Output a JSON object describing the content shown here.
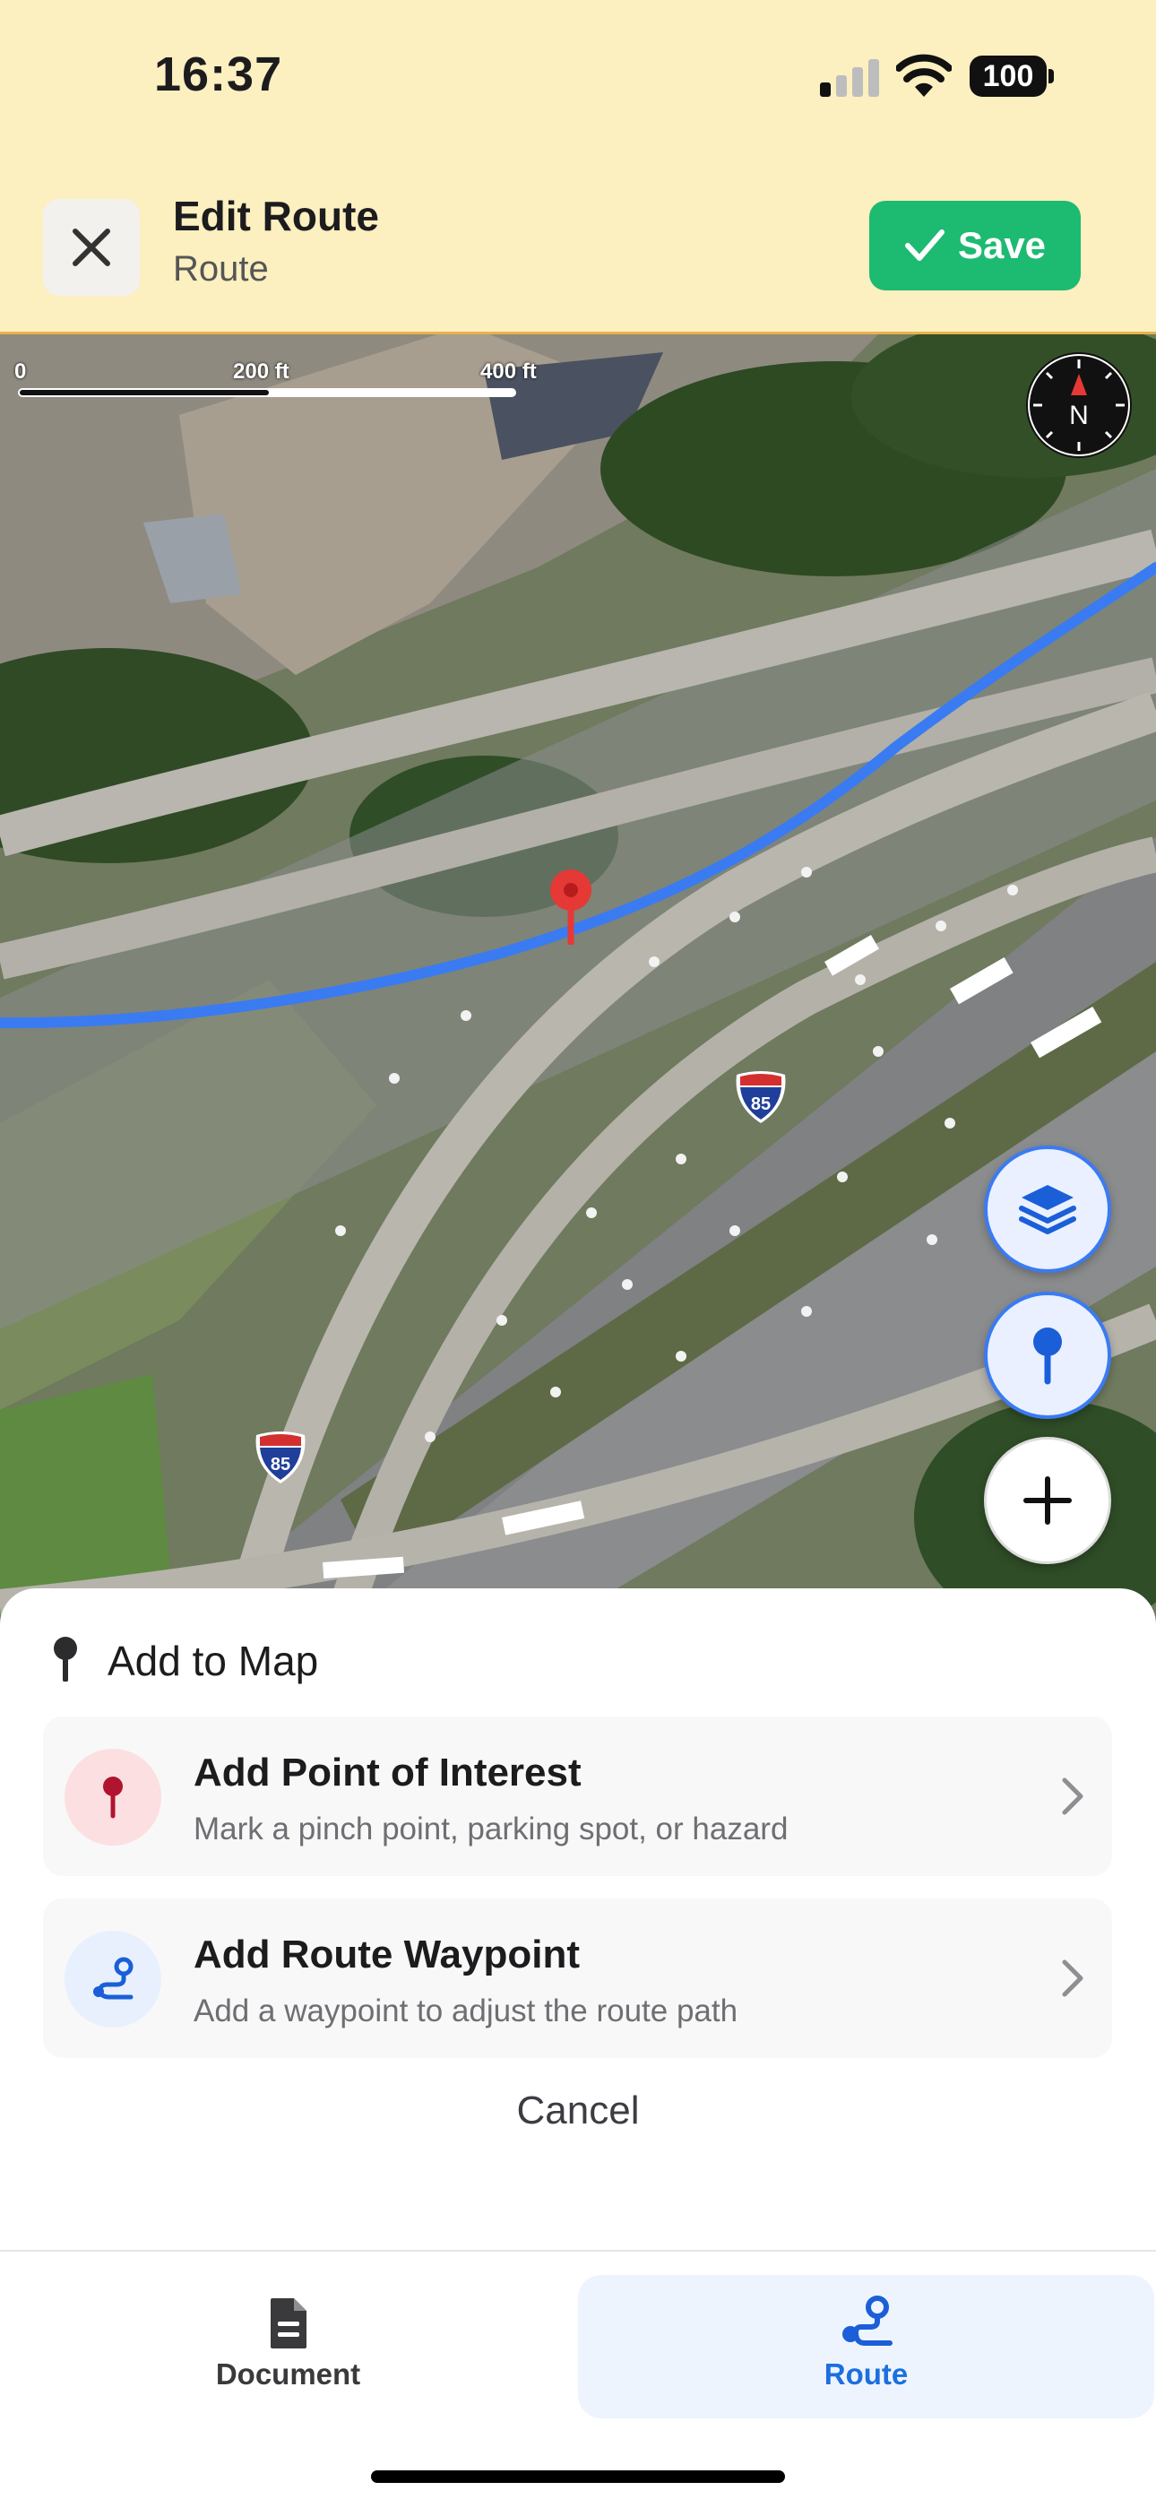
{
  "status_bar": {
    "time": "16:37",
    "battery": "100"
  },
  "header": {
    "title": "Edit Route",
    "subtitle": "Route",
    "save_label": "Save"
  },
  "map": {
    "scale_labels": [
      "0",
      "200 ft",
      "400 ft"
    ],
    "compass_label": "N",
    "shield_label": "85",
    "route_color": "#3a7bf2",
    "pin_color": "#e53935"
  },
  "sheet": {
    "title": "Add to Map",
    "options": [
      {
        "title": "Add Point of Interest",
        "subtitle": "Mark a pinch point, parking spot, or hazard",
        "icon": "pin-icon",
        "icon_bg": "#fcdfe1"
      },
      {
        "title": "Add Route Waypoint",
        "subtitle": "Add a waypoint to adjust the route path",
        "icon": "route-icon",
        "icon_bg": "#e8f0fe"
      }
    ],
    "cancel_label": "Cancel"
  },
  "tabs": [
    {
      "label": "Document",
      "icon": "document-icon",
      "active": false
    },
    {
      "label": "Route",
      "icon": "route-icon",
      "active": true
    }
  ],
  "colors": {
    "header_bg": "#fcefc0",
    "save_green": "#1dba72",
    "accent_blue": "#3a7bf2"
  }
}
